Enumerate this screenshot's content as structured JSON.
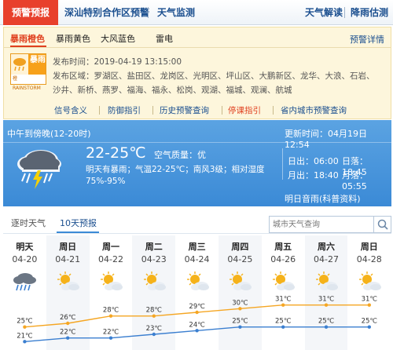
{
  "top_tabs": {
    "warning": "预警预报",
    "zone": "深汕特别合作区预警",
    "monitor": "天气监测",
    "reading": "天气解读",
    "rain": "降雨估测"
  },
  "warning_panel": {
    "tabs": [
      "暴雨橙色",
      "暴雨黄色",
      "大风蓝色",
      "雷电"
    ],
    "detail_link": "预警详情",
    "icon": {
      "label": "暴雨",
      "sublabel": "橙",
      "english": "RAINSTORM"
    },
    "publish_line": "发布时间：2019-04-19 13:15:00",
    "area_line1": "发布区域：罗湖区、盐田区、龙岗区、光明区、坪山区、大鹏新区、龙华、大浪、石岩、",
    "area_line2": "沙井、新桥、燕罗、福海、福永、松岗、观湖、福城、观澜、航城",
    "links": [
      "信号含义",
      "防御指引",
      "历史预警查询",
      "停课指引",
      "省内城市预警查询"
    ]
  },
  "forecast": {
    "period": "中午到傍晚(12-20时)",
    "update": "更新时间：04月19日 12:54",
    "temperature": "22-25℃",
    "air_quality": "空气质量：优",
    "description": "明天有暴雨；气温22-25℃；南风3级；相对湿度75%-95%",
    "sunrise": "日出：06:00",
    "sunset": "日落：18:45",
    "moonrise": "月出：18:40",
    "moonset": "月落：05:55",
    "more": "明日音雨(科普资料)"
  },
  "forecast_tabs": {
    "recent": "逐时天气",
    "tenday": "10天预报"
  },
  "search": {
    "placeholder": "城市天气查询"
  },
  "days": [
    {
      "name": "明天",
      "date": "04-20",
      "icon": "rain-icon"
    },
    {
      "name": "周日",
      "date": "04-21",
      "icon": "sunny-cloudy-icon"
    },
    {
      "name": "周一",
      "date": "04-22",
      "icon": "sunny-cloudy-icon"
    },
    {
      "name": "周二",
      "date": "04-23",
      "icon": "sunny-cloudy-icon"
    },
    {
      "name": "周三",
      "date": "04-24",
      "icon": "sunny-cloudy-icon"
    },
    {
      "name": "周四",
      "date": "04-25",
      "icon": "sunny-cloudy-icon"
    },
    {
      "name": "周五",
      "date": "04-26",
      "icon": "sunny-cloudy-icon"
    },
    {
      "name": "周六",
      "date": "04-27",
      "icon": "sunny-cloudy-icon"
    },
    {
      "name": "周日",
      "date": "04-28",
      "icon": "sunny-cloudy-icon"
    }
  ],
  "chart_data": {
    "type": "line",
    "categories": [
      "04-20",
      "04-21",
      "04-22",
      "04-23",
      "04-24",
      "04-25",
      "04-26",
      "04-27",
      "04-28"
    ],
    "series": [
      {
        "values": [
          25,
          26,
          28,
          28,
          29,
          30,
          31,
          31,
          31
        ],
        "color": "#f5a623"
      },
      {
        "values": [
          21,
          22,
          22,
          23,
          24,
          25,
          25,
          25,
          25
        ],
        "color": "#3b7fd0"
      }
    ],
    "unit": "℃",
    "ylim": [
      20,
      32
    ]
  },
  "colors": {
    "warning_red": "#e8402c",
    "link_blue": "#1b4f8f",
    "forecast_blue": "#3b8ad6",
    "high_line": "#f5a623",
    "low_line": "#3b7fd0"
  }
}
